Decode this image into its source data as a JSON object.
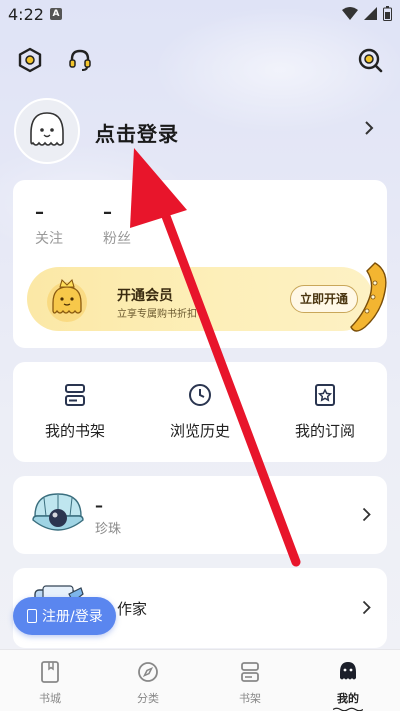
{
  "status_bar": {
    "time": "4:22",
    "notif_icon": "A"
  },
  "top_icons": [
    "settings-hex-icon",
    "headset-icon",
    "scan-icon"
  ],
  "profile": {
    "login_text": "点击登录"
  },
  "stats": [
    {
      "value": "–",
      "label": "关注"
    },
    {
      "value": "–",
      "label": "粉丝"
    }
  ],
  "vip": {
    "title": "开通会员",
    "subtitle": "立享专属购书折扣",
    "button": "立即开通"
  },
  "shortcuts": [
    {
      "label": "我的书架",
      "icon": "bookshelf-icon"
    },
    {
      "label": "浏览历史",
      "icon": "clock-icon"
    },
    {
      "label": "我的订阅",
      "icon": "star-bookmark-icon"
    }
  ],
  "pearl": {
    "value": "–",
    "label": "珍珠"
  },
  "writer": {
    "label": "作家"
  },
  "register": {
    "label": "注册/登录"
  },
  "nav": [
    {
      "label": "书城",
      "active": false
    },
    {
      "label": "分类",
      "active": false
    },
    {
      "label": "书架",
      "active": false
    },
    {
      "label": "我的",
      "active": true
    }
  ],
  "colors": {
    "accent": "#5a86ef",
    "arrow": "#e8152b",
    "vip_bg": "#fbe8a6"
  }
}
